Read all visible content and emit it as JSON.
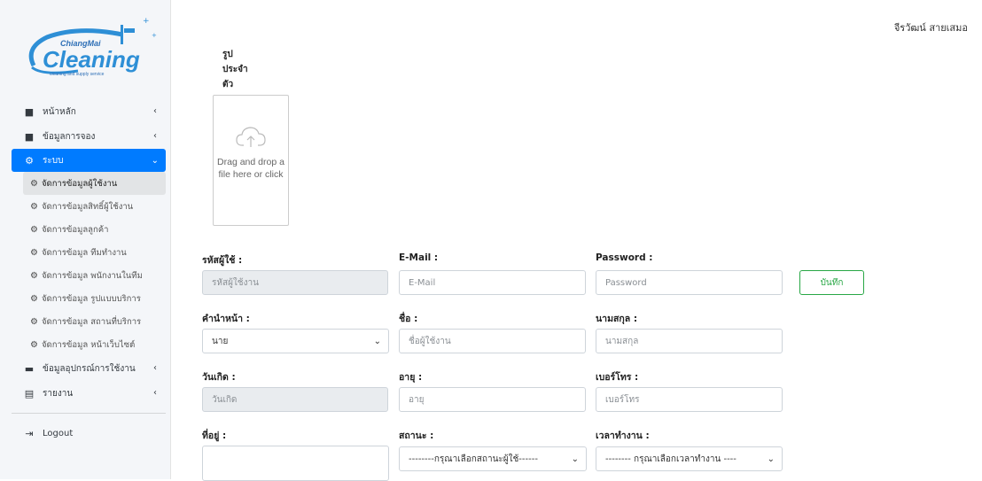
{
  "user": {
    "name": "จีรวัฒน์ สายเสมอ"
  },
  "logo": {
    "brand": "ChiangMai",
    "name": "Cleaning",
    "tagline": "cleaning and supply service"
  },
  "nav": {
    "home": "หน้าหลัก",
    "booking": "ข้อมูลการจอง",
    "system": "ระบบ",
    "sub": [
      "จัดการข้อมูลผู้ใช้งาน",
      "จัดการข้อมูลสิทธิ์ผู้ใช้งาน",
      "จัดการข้อมูลลูกค้า",
      "จัดการข้อมูล ทีมทำงาน",
      "จัดการข้อมูล พนักงานในทีม",
      "จัดการข้อมูล รูปแบบบริการ",
      "จัดการข้อมูล สถานที่บริการ",
      "จัดการข้อมูล หน้าเว็บไซต์"
    ],
    "equipment": "ข้อมูลอุปกรณ์การใช้งาน",
    "report": "รายงาน",
    "logout": "Logout"
  },
  "photo": {
    "label_lines": [
      "รูป",
      "ประจำ",
      "ตัว"
    ],
    "dropzone_text": "Drag and drop a file here or click"
  },
  "form": {
    "user_id": {
      "label": "รหัสผู้ใช้ :",
      "placeholder": "รหัสผู้ใช้งาน"
    },
    "email": {
      "label": "E-Mail :",
      "placeholder": "E-Mail"
    },
    "password": {
      "label": "Password :",
      "placeholder": "Password"
    },
    "save": "บันทึก",
    "prefix": {
      "label": "คำนำหน้า :",
      "value": "นาย"
    },
    "first_name": {
      "label": "ชื่อ :",
      "placeholder": "ชื่อผู้ใช้งาน"
    },
    "last_name": {
      "label": "นามสกุล :",
      "placeholder": "นามสกุล"
    },
    "birthday": {
      "label": "วันเกิด :",
      "placeholder": "วันเกิด"
    },
    "age": {
      "label": "อายุ :",
      "placeholder": "อายุ"
    },
    "phone": {
      "label": "เบอร์โทร :",
      "placeholder": "เบอร์โทร"
    },
    "address": {
      "label": "ที่อยู่ :"
    },
    "status": {
      "label": "สถานะ :",
      "value": "--------กรุณาเลือกสถานะผู้ใช้------"
    },
    "work_time": {
      "label": "เวลาทำงาน :",
      "value": "-------- กรุณาเลือกเวลาทำงาน ----"
    }
  },
  "colors": {
    "primary": "#007bff",
    "success": "#28a745",
    "sidebar": "#f4f6f9"
  }
}
